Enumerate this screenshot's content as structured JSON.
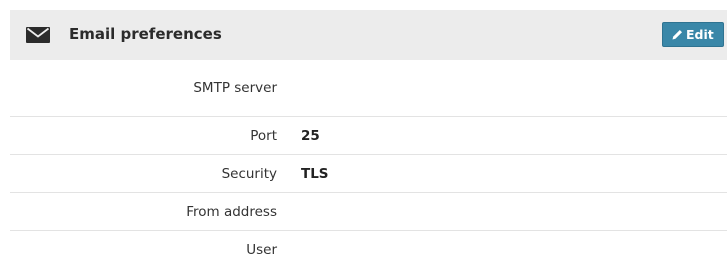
{
  "header": {
    "icon": "envelope-icon",
    "title": "Email preferences",
    "edit_icon": "pencil-icon",
    "edit_label": "Edit",
    "edit_color": "#3a87a8"
  },
  "fields": [
    {
      "label": "SMTP server",
      "value": ""
    },
    {
      "label": "Port",
      "value": "25"
    },
    {
      "label": "Security",
      "value": "TLS"
    },
    {
      "label": "From address",
      "value": ""
    },
    {
      "label": "User",
      "value": ""
    }
  ]
}
